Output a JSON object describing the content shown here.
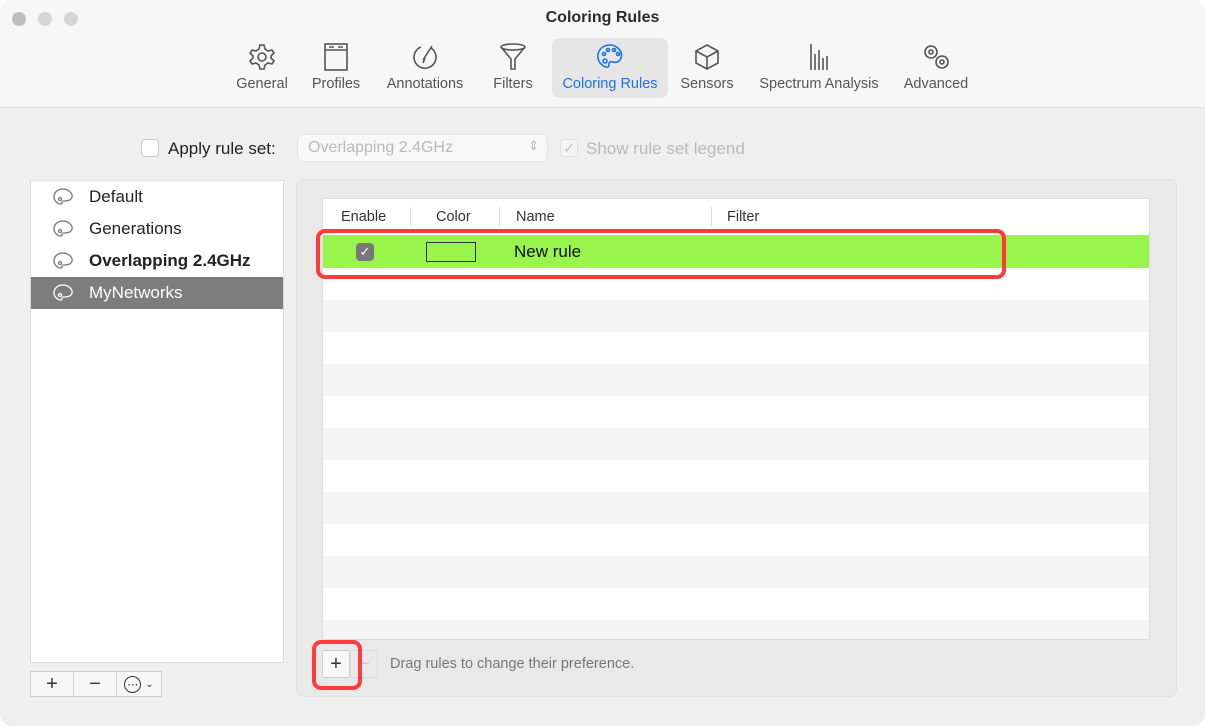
{
  "window": {
    "title": "Coloring Rules"
  },
  "toolbar": [
    {
      "label": "General",
      "icon": "gear-icon"
    },
    {
      "label": "Profiles",
      "icon": "profiles-icon"
    },
    {
      "label": "Annotations",
      "icon": "annotations-icon"
    },
    {
      "label": "Filters",
      "icon": "funnel-icon"
    },
    {
      "label": "Coloring Rules",
      "icon": "palette-icon",
      "selected": true
    },
    {
      "label": "Sensors",
      "icon": "cube-icon"
    },
    {
      "label": "Spectrum Analysis",
      "icon": "spectrum-icon"
    },
    {
      "label": "Advanced",
      "icon": "gears-icon"
    }
  ],
  "options": {
    "apply_label": "Apply rule set:",
    "apply_checked": false,
    "rule_set_value": "Overlapping 2.4GHz",
    "legend_label": "Show rule set legend",
    "legend_checked": true
  },
  "rule_sets": [
    {
      "label": "Default"
    },
    {
      "label": "Generations"
    },
    {
      "label": "Overlapping 2.4GHz",
      "bold": true
    },
    {
      "label": "MyNetworks",
      "selected": true
    }
  ],
  "rule_set_buttons": {
    "add": "+",
    "remove": "−",
    "more": "⋯"
  },
  "table": {
    "headers": [
      "Enable",
      "Color",
      "Name",
      "Filter"
    ],
    "rows": [
      {
        "enabled": true,
        "color": "#99f54b",
        "name": "New rule",
        "filter": ""
      }
    ]
  },
  "footer": {
    "add": "+",
    "remove": "−",
    "hint": "Drag rules to change their preference."
  },
  "colors": {
    "accent": "#1a73e8",
    "highlight": "#ff3b3b",
    "rule_color": "#99f54b"
  }
}
